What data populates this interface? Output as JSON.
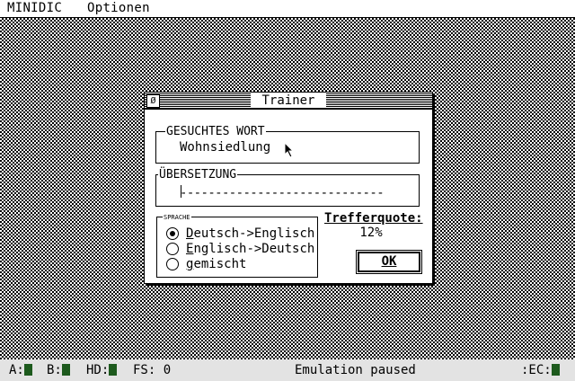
{
  "menubar": {
    "items": [
      "MINIDIC",
      "Optionen"
    ]
  },
  "window": {
    "title": "Trainer",
    "close_glyph": "Ø",
    "word_group": {
      "label": "GESUCHTES WORT",
      "value": "Wohnsiedlung"
    },
    "translation_group": {
      "label": "ÜBERSETZUNG",
      "value": "-----------------------------"
    },
    "language_group": {
      "label": "SPRACHE",
      "options": [
        {
          "first": "D",
          "rest": "eutsch->Englisch",
          "checked": true
        },
        {
          "first": "E",
          "rest": "nglisch->Deutsch",
          "checked": false
        },
        {
          "first": "g",
          "rest": "emischt",
          "checked": false
        }
      ]
    },
    "quote": {
      "title": "Trefferquote:",
      "value": "12%"
    },
    "ok_button": {
      "label": "OK"
    }
  },
  "statusbar": {
    "drive_a": "A:",
    "drive_b": "B:",
    "hd": "HD:",
    "fs": "FS: 0",
    "message": "Emulation paused",
    "ec": ":EC:"
  },
  "colors": {
    "led": "#1d5a1d",
    "statusbar": "#e3e3e3"
  }
}
